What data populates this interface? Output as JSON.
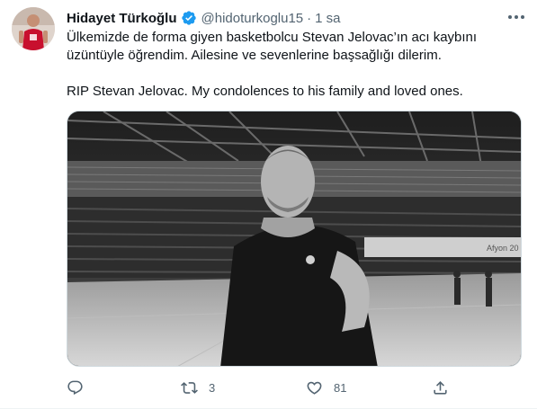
{
  "author": {
    "name": "Hidayet Türkoğlu",
    "handle": "@hidoturkoglu15",
    "separator": "·",
    "time": "1 sa"
  },
  "tweet": {
    "line1": "Ülkemizde de forma giyen basketbolcu Stevan Jelovac’ın acı kaybını",
    "line2": "üzüntüyle öğrendim. Ailesine ve sevenlerine başsağlığı dilerim.",
    "line3": "RIP Stevan Jelovac. My condolences to his family and loved ones."
  },
  "media": {
    "banner_text": "Afyon 20"
  },
  "actions": {
    "reply_count": "",
    "retweet_count": "3",
    "like_count": "81"
  },
  "colors": {
    "text": "#0f1419",
    "secondary": "#536471",
    "verified": "#1d9bf0"
  },
  "icons": [
    "verified-badge-icon",
    "more-icon",
    "reply-icon",
    "retweet-icon",
    "like-icon",
    "share-icon"
  ]
}
